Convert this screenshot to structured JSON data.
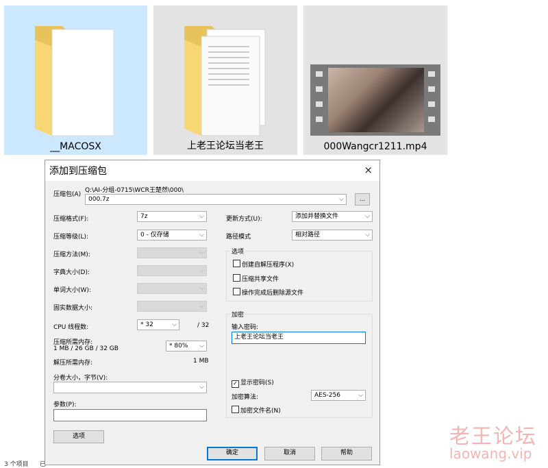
{
  "explorer": {
    "items": [
      {
        "name": "__MACOSX",
        "icon": "folder-icon",
        "selected": true
      },
      {
        "name": "上老王论坛当老王",
        "icon": "folder-icon",
        "selected": false
      },
      {
        "name": "000Wangcr1211.mp4",
        "icon": "video-thumbnail",
        "selected": false
      }
    ],
    "status_count": "3 个项目",
    "status_partial": "已"
  },
  "dialog": {
    "title": "添加到压缩包",
    "close": "×",
    "archive_label": "压缩包(A)",
    "archive_path": "Q:\\AI-分组-0715\\WCR王楚然\\000\\",
    "archive_name": "000.7z",
    "browse": "...",
    "format_label": "压缩格式(F):",
    "format_value": "7z",
    "level_label": "压缩等级(L):",
    "level_value": "0 - 仅存储",
    "method_label": "压缩方法(M):",
    "dict_label": "字典大小(D):",
    "word_label": "单词大小(W):",
    "solid_label": "固实数据大小:",
    "cpu_label": "CPU 线程数:",
    "cpu_value": "* 32",
    "cpu_max": "/ 32",
    "mem_label": "压缩所需内存:",
    "mem_detail": "1 MB / 26 GB / 32 GB",
    "mem_value": "* 80%",
    "decomp_label": "解压所需内存:",
    "decomp_value": "1 MB",
    "split_label": "分卷大小，字节(V):",
    "params_label": "参数(P):",
    "options_button": "选项",
    "update_label": "更新方式(U):",
    "update_value": "添加并替换文件",
    "path_label": "路径模式",
    "path_value": "相对路径",
    "options_group": "选项",
    "opt_sfx": "创建自解压程序(X)",
    "opt_shared": "压缩共享文件",
    "opt_delete": "操作完成后删除源文件",
    "enc_group": "加密",
    "pwd_label": "输入密码:",
    "pwd_value": "上老王论坛当老王",
    "show_pwd": "显示密码(S)",
    "algo_label": "加密算法:",
    "algo_value": "AES-256",
    "enc_names": "加密文件名(N)",
    "ok": "确定",
    "cancel": "取消",
    "help": "帮助"
  },
  "watermark": {
    "cn": "老王论坛",
    "url": "laowang.vip"
  }
}
